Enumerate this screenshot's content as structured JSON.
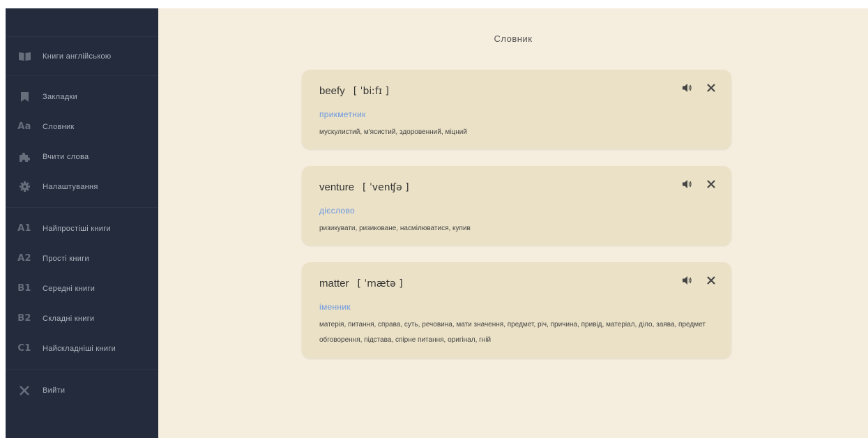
{
  "sidebar": {
    "items": [
      {
        "label": "Книги англійською"
      },
      {
        "label": "Закладки"
      },
      {
        "label": "Словник",
        "icon_text": "Aa"
      },
      {
        "label": "Вчити слова"
      },
      {
        "label": "Налаштування"
      },
      {
        "label": "Найпростіші книги",
        "icon_text": "A1"
      },
      {
        "label": "Прості книги",
        "icon_text": "A2"
      },
      {
        "label": "Середні книги",
        "icon_text": "B1"
      },
      {
        "label": "Складні книги",
        "icon_text": "B2"
      },
      {
        "label": "Найскладніші книги",
        "icon_text": "C1"
      },
      {
        "label": "Вийти"
      }
    ]
  },
  "main": {
    "title": "Словник",
    "cards": [
      {
        "word": "beefy",
        "transcription": "[ ˈbiːfɪ ]",
        "pos": "прикметник",
        "translation": "мускулистий, м'ясистий, здоровенний, міцний"
      },
      {
        "word": "venture",
        "transcription": "[ ˈvenʧə ]",
        "pos": "дієслово",
        "translation": "ризикувати, ризиковане, насмілюватися, купив"
      },
      {
        "word": "matter",
        "transcription": "[ ˈmætə ]",
        "pos": "іменник",
        "translation": "матерія, питання, справа, суть, речовина, мати значення, предмет, річ, причина, привід, матеріал, діло, заява, предмет обговорення, підстава, спірне питання, оригінал, гній"
      }
    ]
  },
  "colors": {
    "sidebar_bg": "#232b3d",
    "main_bg": "#f5eddd",
    "card_bg": "#ebe1c6",
    "accent": "#6c98e0"
  }
}
